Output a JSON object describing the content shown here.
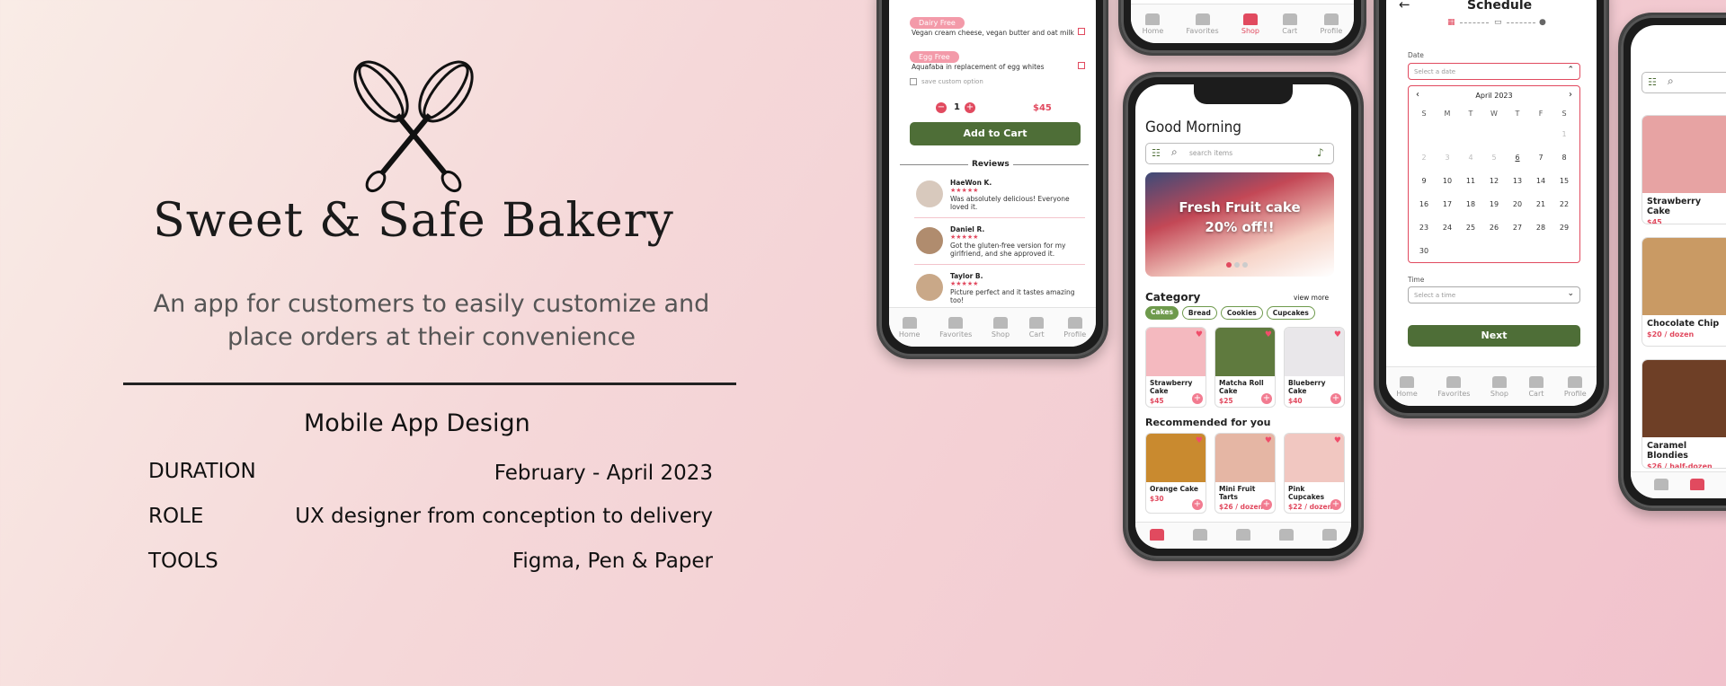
{
  "brand": {
    "title": "Sweet & Safe Bakery",
    "tagline_line1": "An app for customers to easily customize and",
    "tagline_line2": "place orders at their convenience"
  },
  "project": {
    "subtitle": "Mobile App Design",
    "rows": [
      {
        "label": "DURATION",
        "value": "February - April 2023"
      },
      {
        "label": "ROLE",
        "value": "UX designer from conception to delivery"
      },
      {
        "label": "TOOLS",
        "value": "Figma, Pen & Paper"
      }
    ]
  },
  "tabs": [
    "Home",
    "Favorites",
    "Shop",
    "Cart",
    "Profile"
  ],
  "product_screen": {
    "option1_chip": "Dairy Free",
    "option1_text": "Vegan cream cheese, vegan butter and oat milk",
    "option2_chip": "Egg Free",
    "option2_text": "Aquafaba in replacement of egg whites",
    "save_option": "save custom option",
    "quantity": "1",
    "price": "$45",
    "add_to_cart": "Add to Cart",
    "reviews_title": "Reviews",
    "reviews": [
      {
        "name": "HaeWon K.",
        "stars": "★★★★★",
        "text1": "Was absolutely delicious! Everyone",
        "text2": "loved it."
      },
      {
        "name": "Daniel R.",
        "stars": "★★★★★",
        "text1": "Got the gluten-free version for my",
        "text2": "girlfriend, and she approved it."
      },
      {
        "name": "Taylor B.",
        "stars": "★★★★★",
        "text1": "Picture perfect and it tastes amazing",
        "text2": "too!"
      }
    ]
  },
  "home_screen": {
    "greeting": "Good Morning",
    "search_placeholder": "search items",
    "banner_line1": "Fresh Fruit cake",
    "banner_line2": "20% off!!",
    "category_title": "Category",
    "view_more": "view more",
    "categories": [
      "Cakes",
      "Bread",
      "Cookies",
      "Cupcakes"
    ],
    "items": [
      {
        "name": "Strawberry Cake",
        "price": "$45"
      },
      {
        "name": "Matcha Roll Cake",
        "price": "$25"
      },
      {
        "name": "Blueberry Cake",
        "price": "$40"
      }
    ],
    "recommended_title": "Recommended for you",
    "recommended": [
      {
        "name": "Orange Cake",
        "price": "$30"
      },
      {
        "name": "Mini Fruit Tarts",
        "price": "$26 / dozen"
      },
      {
        "name": "Pink Cupcakes",
        "price": "$22 / dozen"
      }
    ]
  },
  "schedule_screen": {
    "title": "Schedule",
    "date_label": "Date",
    "date_placeholder": "Select a date",
    "month": "April 2023",
    "weekdays": [
      "S",
      "M",
      "T",
      "W",
      "T",
      "F",
      "S"
    ],
    "time_label": "Time",
    "time_placeholder": "Select a time",
    "next": "Next"
  },
  "shop_screen": {
    "items": [
      {
        "name": "Strawberry Cake",
        "price": "$45"
      },
      {
        "name": "Chocolate Chip",
        "price": "$20 / dozen"
      },
      {
        "name": "Caramel Blondies",
        "price": "$26 / half-dozen"
      }
    ]
  },
  "colors": {
    "accent_green": "#4e6e37",
    "accent_pink": "#e14a5f"
  }
}
